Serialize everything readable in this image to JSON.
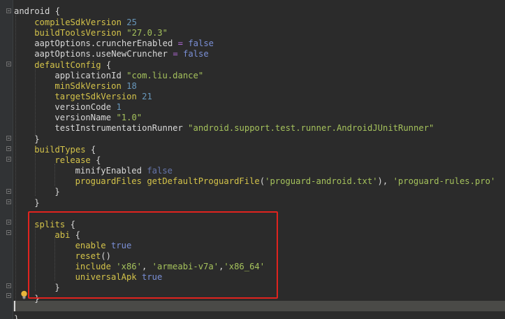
{
  "editor": {
    "lines": [
      {
        "tokens": [
          {
            "t": "android {",
            "c": "ident"
          }
        ]
      },
      {
        "tokens": [
          {
            "t": "compileSdkVersion ",
            "c": "prop"
          },
          {
            "t": "25",
            "c": "num"
          }
        ]
      },
      {
        "tokens": [
          {
            "t": "buildToolsVersion ",
            "c": "prop"
          },
          {
            "t": "\"27.0.3\"",
            "c": "str"
          }
        ]
      },
      {
        "tokens": [
          {
            "t": "aaptOptions.cruncherEnabled ",
            "c": "ident"
          },
          {
            "t": "= ",
            "c": "lilac"
          },
          {
            "t": "false",
            "c": "bool"
          }
        ]
      },
      {
        "tokens": [
          {
            "t": "aaptOptions.useNewCruncher ",
            "c": "ident"
          },
          {
            "t": "= ",
            "c": "lilac"
          },
          {
            "t": "false",
            "c": "bool"
          }
        ]
      },
      {
        "tokens": [
          {
            "t": "defaultConfig ",
            "c": "prop"
          },
          {
            "t": "{",
            "c": "ident"
          }
        ]
      },
      {
        "tokens": [
          {
            "t": "applicationId ",
            "c": "ident"
          },
          {
            "t": "\"com.liu.dance\"",
            "c": "str"
          }
        ]
      },
      {
        "tokens": [
          {
            "t": "minSdkVersion ",
            "c": "prop"
          },
          {
            "t": "18",
            "c": "num"
          }
        ]
      },
      {
        "tokens": [
          {
            "t": "targetSdkVersion ",
            "c": "prop"
          },
          {
            "t": "21",
            "c": "num"
          }
        ]
      },
      {
        "tokens": [
          {
            "t": "versionCode ",
            "c": "ident"
          },
          {
            "t": "1",
            "c": "num"
          }
        ]
      },
      {
        "tokens": [
          {
            "t": "versionName ",
            "c": "ident"
          },
          {
            "t": "\"1.0\"",
            "c": "str"
          }
        ]
      },
      {
        "tokens": [
          {
            "t": "testInstrumentationRunner ",
            "c": "ident"
          },
          {
            "t": "\"android.support.test.runner.AndroidJUnitRunner\"",
            "c": "str"
          }
        ]
      },
      {
        "tokens": [
          {
            "t": "}",
            "c": "ident"
          }
        ]
      },
      {
        "tokens": [
          {
            "t": "buildTypes ",
            "c": "prop"
          },
          {
            "t": "{",
            "c": "ident"
          }
        ]
      },
      {
        "tokens": [
          {
            "t": "release ",
            "c": "prop"
          },
          {
            "t": "{",
            "c": "ident"
          }
        ]
      },
      {
        "tokens": [
          {
            "t": "minifyEnabled ",
            "c": "ident"
          },
          {
            "t": "false",
            "c": "dim"
          }
        ]
      },
      {
        "tokens": [
          {
            "t": "proguardFiles ",
            "c": "prop"
          },
          {
            "t": "getDefaultProguardFile",
            "c": "meth"
          },
          {
            "t": "(",
            "c": "ident"
          },
          {
            "t": "'proguard-android.txt'",
            "c": "str"
          },
          {
            "t": "), ",
            "c": "ident"
          },
          {
            "t": "'proguard-rules.pro'",
            "c": "str"
          }
        ]
      },
      {
        "tokens": [
          {
            "t": "}",
            "c": "ident"
          }
        ]
      },
      {
        "tokens": [
          {
            "t": "}",
            "c": "ident"
          }
        ]
      },
      {
        "tokens": []
      },
      {
        "tokens": [
          {
            "t": "splits ",
            "c": "prop"
          },
          {
            "t": "{",
            "c": "ident"
          }
        ]
      },
      {
        "tokens": [
          {
            "t": "abi ",
            "c": "prop"
          },
          {
            "t": "{",
            "c": "ident"
          }
        ]
      },
      {
        "tokens": [
          {
            "t": "enable ",
            "c": "prop"
          },
          {
            "t": "true",
            "c": "bool"
          }
        ]
      },
      {
        "tokens": [
          {
            "t": "reset",
            "c": "prop"
          },
          {
            "t": "()",
            "c": "ident"
          }
        ]
      },
      {
        "tokens": [
          {
            "t": "include ",
            "c": "prop"
          },
          {
            "t": "'x86'",
            "c": "str"
          },
          {
            "t": ", ",
            "c": "ident"
          },
          {
            "t": "'armeabi-v7a'",
            "c": "str"
          },
          {
            "t": ",",
            "c": "ident"
          },
          {
            "t": "'x86_64'",
            "c": "str"
          }
        ]
      },
      {
        "tokens": [
          {
            "t": "universalApk ",
            "c": "prop"
          },
          {
            "t": "true",
            "c": "bool"
          }
        ]
      },
      {
        "tokens": [
          {
            "t": "}",
            "c": "ident"
          }
        ]
      },
      {
        "tokens": [
          {
            "t": "}",
            "c": "ident"
          }
        ]
      },
      {
        "tokens": []
      },
      {
        "tokens": [
          {
            "t": "}",
            "c": "ident"
          }
        ]
      }
    ]
  },
  "icons": {
    "fold_marker": "fold-marker-icon",
    "intention_bulb": "lightbulb-icon"
  },
  "colors": {
    "background": "#2b2b2b",
    "highlight_border": "#e0231e",
    "string": "#a5c25c",
    "number": "#6897bb",
    "keyword_bool": "#7a8fd6",
    "property": "#d4c34a"
  }
}
